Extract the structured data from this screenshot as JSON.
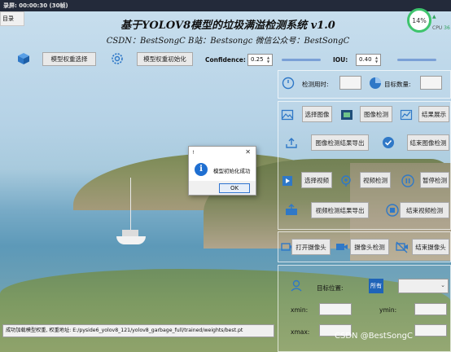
{
  "window": {
    "title": "录屏: 00:00:30 (30帧)",
    "menu": "目录"
  },
  "header": {
    "title": "基于YOLOV8模型的垃圾满溢检测系统 v1.0",
    "subtitle": "CSDN：BestSongC   B站：Bestsongc   微信公众号：BestSongC"
  },
  "monitor": {
    "percent": "14%",
    "cpu_label": "CPU",
    "cpu_value": "36"
  },
  "toolbar": {
    "model_button": "模型权重选择",
    "init_button": "模型权重初始化",
    "confidence_label": "Confidence:",
    "confidence_value": "0.25",
    "iou_label": "IOU:",
    "iou_value": "0.40"
  },
  "stats": {
    "time_label": "检测用时:",
    "count_label": "目标数量:"
  },
  "image_section": {
    "select_image": "选择图像",
    "image_detect": "图像检测",
    "result_show": "结果展示",
    "export_result": "图像检测结果导出",
    "end_image_detect": "结束图像检测"
  },
  "video_section": {
    "select_video": "选择视频",
    "video_detect": "视频检测",
    "pause_detect": "暂停检测",
    "export_result": "视频检测结果导出",
    "end_video_detect": "结束视频检测"
  },
  "camera_section": {
    "open_camera": "打开摄像头",
    "camera_detect": "摄像头检测",
    "close_camera": "结束摄像头"
  },
  "position": {
    "label": "目标位置:",
    "all_label": "所有",
    "xmin": "xmin:",
    "ymin": "ymin:",
    "xmax": "xmax:"
  },
  "status": {
    "text": "成功加载模型权重, 权重地址: E:/pyside6_yolov8_121/yolov8_garbage_full/trained/weights/best.pt"
  },
  "dialog": {
    "title": "!",
    "message": "模型初始化成功",
    "ok": "OK"
  },
  "watermark": "CSDN @BestSongC"
}
